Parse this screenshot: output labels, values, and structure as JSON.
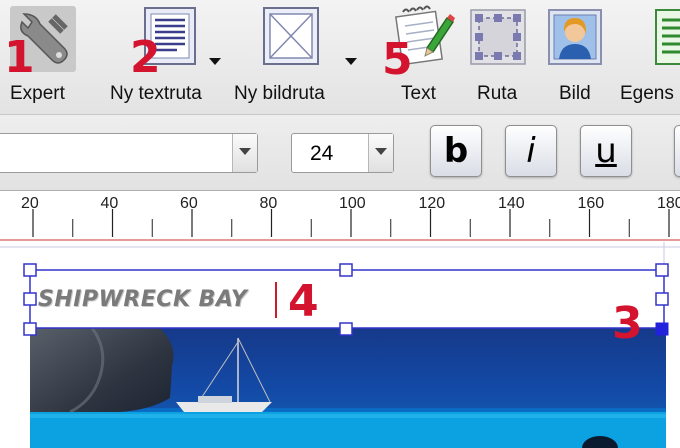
{
  "toolbar": {
    "expert": {
      "label": "Expert",
      "number": "1"
    },
    "new_textbox": {
      "label": "Ny textruta",
      "number": "2"
    },
    "new_imagebox": {
      "label": "Ny bildruta"
    },
    "text": {
      "label": "Text",
      "number": "5"
    },
    "box": {
      "label": "Ruta"
    },
    "image": {
      "label": "Bild"
    },
    "properties": {
      "label": "Egens"
    }
  },
  "format": {
    "font_value": "",
    "size_value": "24",
    "bold_label": "b",
    "italic_label": "i",
    "underline_label": "u"
  },
  "ruler": {
    "ticks": [
      "20",
      "40",
      "60",
      "80",
      "100",
      "120",
      "140",
      "160",
      "180"
    ]
  },
  "document": {
    "textbox_text": "SHIPWRECK BAY",
    "textbox_number": "4",
    "handle_number": "3"
  },
  "colors": {
    "callout_red": "#d4142e",
    "selection_blue": "#3333cc",
    "toolbar_bg": "#e8e8e8"
  }
}
